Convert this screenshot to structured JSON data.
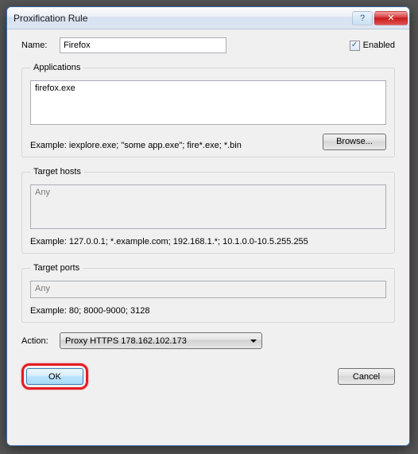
{
  "window": {
    "title": "Proxification Rule"
  },
  "titlebar": {
    "help": "?",
    "close": "✕"
  },
  "name": {
    "label": "Name:",
    "value": "Firefox"
  },
  "enabled": {
    "label": "Enabled",
    "checked": true
  },
  "applications": {
    "legend": "Applications",
    "value": "firefox.exe",
    "example": "Example: iexplore.exe; \"some app.exe\"; fire*.exe; *.bin",
    "browse": "Browse..."
  },
  "targetHosts": {
    "legend": "Target hosts",
    "value": "Any",
    "example": "Example: 127.0.0.1; *.example.com; 192.168.1.*; 10.1.0.0-10.5.255.255"
  },
  "targetPorts": {
    "legend": "Target ports",
    "value": "Any",
    "example": "Example: 80; 8000-9000; 3128"
  },
  "action": {
    "label": "Action:",
    "selected": "Proxy HTTPS 178.162.102.173"
  },
  "buttons": {
    "ok": "OK",
    "cancel": "Cancel"
  }
}
